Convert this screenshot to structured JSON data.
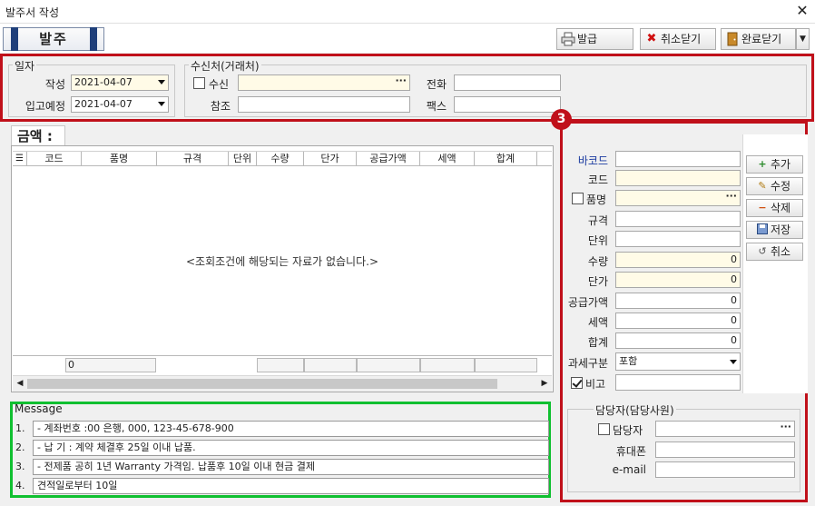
{
  "window": {
    "title": "발주서 작성",
    "close_icon": "✕"
  },
  "toolbar": {
    "doc_type": "발주",
    "print_label": "발급",
    "cancel_close_label": "취소닫기",
    "done_close_label": "완료닫기"
  },
  "dates": {
    "group_label": "일자",
    "written_label": "작성",
    "written_value": "2021-04-07",
    "arrival_label": "입고예정",
    "arrival_value": "2021-04-07"
  },
  "recipient": {
    "group_label": "수신처(거래처)",
    "recv_label": "수신",
    "recv_value": "",
    "ref_label": "참조",
    "ref_value": "",
    "phone_label": "전화",
    "phone_value": "",
    "fax_label": "팩스",
    "fax_value": ""
  },
  "grid": {
    "tab_label": "금액 :",
    "columns": [
      "코드",
      "품명",
      "규격",
      "단위",
      "수량",
      "단가",
      "공급가액",
      "세액",
      "합계"
    ],
    "empty_message": "<조회조건에 해당되는 자료가 없습니다.>",
    "footer_count": "0"
  },
  "marker": "3",
  "item_form": {
    "barcode_label": "바코드",
    "code_label": "코드",
    "name_label": "품명",
    "spec_label": "규격",
    "unit_label": "단위",
    "qty_label": "수량",
    "qty_value": "0",
    "price_label": "단가",
    "price_value": "0",
    "supply_label": "공급가액",
    "supply_value": "0",
    "tax_label": "세액",
    "tax_value": "0",
    "total_label": "합계",
    "total_value": "0",
    "tax_type_label": "과세구분",
    "tax_type_value": "포함",
    "note_label": "비고"
  },
  "side_buttons": {
    "add": "추가",
    "edit": "수정",
    "delete": "삭제",
    "save": "저장",
    "cancel": "취소"
  },
  "message": {
    "group_label": "Message",
    "lines": [
      {
        "num": "1.",
        "text": "- 계좌번호 :00 은행, 000, 123-45-678-900"
      },
      {
        "num": "2.",
        "text": "- 납 기 : 계약 체결후 25일 이내 납품."
      },
      {
        "num": "3.",
        "text": "- 전제품 공히 1년 Warranty 가격임. 납품후 10일 이내 현금 결제"
      },
      {
        "num": "4.",
        "text": "견적일로부터 10일"
      }
    ]
  },
  "manager": {
    "group_label": "담당자(담당사원)",
    "manager_label": "담당자",
    "mobile_label": "휴대폰",
    "email_label": "e-mail"
  },
  "colors": {
    "highlight_red": "#c0101a",
    "highlight_green": "#10c030",
    "link_blue": "#1a3aa0"
  }
}
